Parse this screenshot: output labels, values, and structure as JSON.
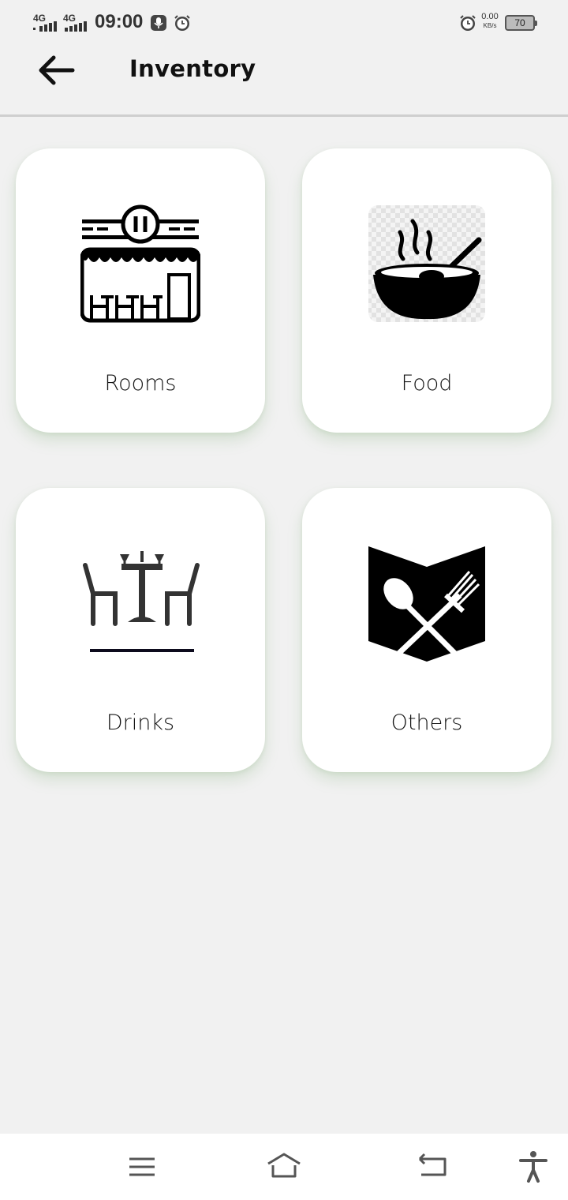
{
  "status_bar": {
    "network_1": "4G",
    "network_2": "4G",
    "time": "09:00",
    "net_speed_value": "0.00",
    "net_speed_unit": "KB/s",
    "battery_level": "70"
  },
  "header": {
    "title": "Inventory",
    "back_icon": "arrow-left-icon"
  },
  "categories": [
    {
      "label": "Rooms",
      "icon": "restaurant-storefront-icon"
    },
    {
      "label": "Food",
      "icon": "steaming-bowl-icon"
    },
    {
      "label": "Drinks",
      "icon": "table-chairs-icon"
    },
    {
      "label": "Others",
      "icon": "menu-cutlery-icon"
    }
  ],
  "nav_bar": {
    "icons": [
      "menu-icon",
      "home-icon",
      "back-icon",
      "accessibility-icon"
    ]
  },
  "colors": {
    "background": "#f1f1f1",
    "card": "#ffffff",
    "card_shadow": "#78aa6e",
    "text": "#111111"
  }
}
